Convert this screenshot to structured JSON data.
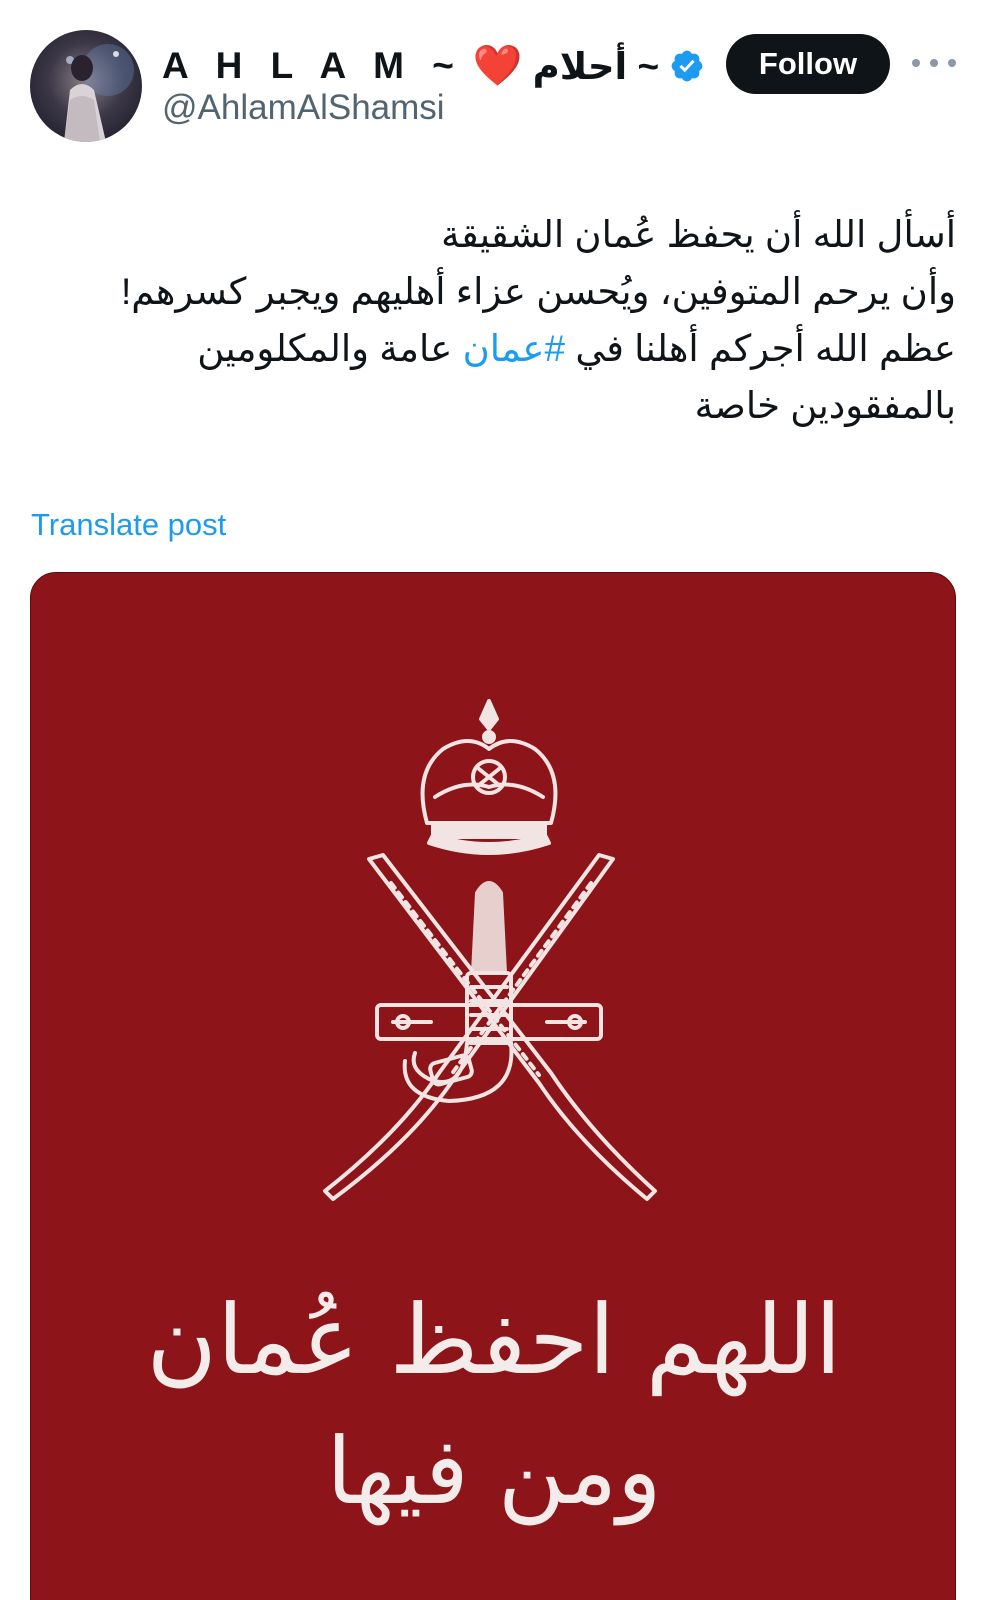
{
  "author": {
    "name_latin": "A H L A M ~",
    "name_emoji": "❤️",
    "name_arabic": "~ أحلام",
    "handle": "@AhlamAlShamsi",
    "verified_color": "#1d9bf0"
  },
  "actions": {
    "follow_label": "Follow",
    "more_label": "More"
  },
  "tweet": {
    "line1": "أسأل الله أن يحفظ عُمان الشقيقة",
    "line2": "وأن يرحم  المتوفين، ويُحسن عزاء أهليهم ويجبر كسرهم!",
    "line3_before": "عظم الله أجركم أهلنا في ",
    "hashtag": "#عمان",
    "line3_after": " عامة والمكلومين",
    "line4": "بالمفقودين خاصة",
    "translate_label": "Translate post"
  },
  "media": {
    "background_color": "#8d1418",
    "emblem": "oman-national-emblem",
    "calligraphy": "اللهم احفظ عُمان ومن فيها"
  }
}
